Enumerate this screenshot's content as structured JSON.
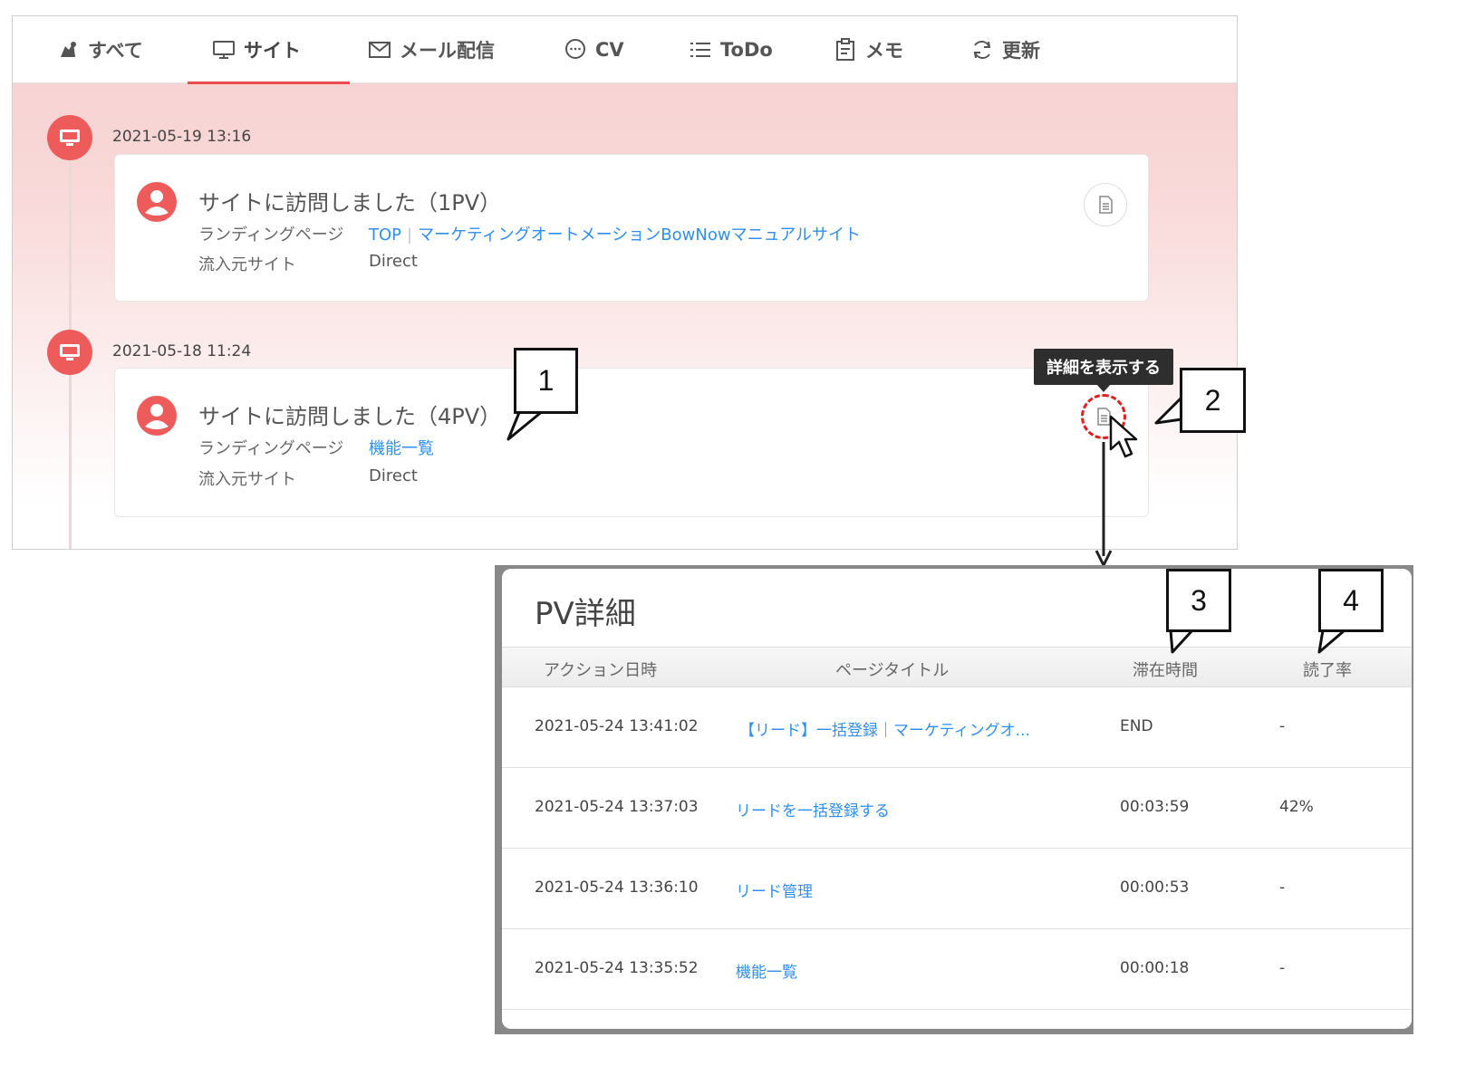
{
  "tabs": [
    {
      "label": "すべて",
      "icon": "all-icon"
    },
    {
      "label": "サイト",
      "icon": "monitor-icon",
      "active": true
    },
    {
      "label": "メール配信",
      "icon": "mail-icon"
    },
    {
      "label": "CV",
      "icon": "chat-bubble-icon"
    },
    {
      "label": "ToDo",
      "icon": "list-icon"
    },
    {
      "label": "メモ",
      "icon": "clipboard-icon"
    },
    {
      "label": "更新",
      "icon": "refresh-icon"
    }
  ],
  "timeline": [
    {
      "date": "2021-05-19 13:16",
      "title": "サイトに訪問しました（1PV）",
      "landing_label": "ランディングページ",
      "landing_link_1": "TOP",
      "landing_sep": "|",
      "landing_link_2": "マーケティングオートメーションBowNowマニュアルサイト",
      "referrer_label": "流入元サイト",
      "referrer_value": "Direct"
    },
    {
      "date": "2021-05-18 11:24",
      "title": "サイトに訪問しました（4PV）",
      "landing_label": "ランディングページ",
      "landing_link_1": "機能一覧",
      "referrer_label": "流入元サイト",
      "referrer_value": "Direct"
    }
  ],
  "tooltip": "詳細を表示する",
  "callouts": [
    "1",
    "2",
    "3",
    "4"
  ],
  "modal": {
    "title": "PV詳細",
    "columns": [
      "アクション日時",
      "ページタイトル",
      "滞在時間",
      "読了率"
    ],
    "rows": [
      {
        "datetime": "2021-05-24 13:41:02",
        "page": "【リード】一括登録｜マーケティングオ...",
        "duration": "END",
        "read_rate": "-"
      },
      {
        "datetime": "2021-05-24 13:37:03",
        "page": "リードを一括登録する",
        "duration": "00:03:59",
        "read_rate": "42%"
      },
      {
        "datetime": "2021-05-24 13:36:10",
        "page": "リード管理",
        "duration": "00:00:53",
        "read_rate": "-"
      },
      {
        "datetime": "2021-05-24 13:35:52",
        "page": "機能一覧",
        "duration": "00:00:18",
        "read_rate": "-"
      }
    ]
  },
  "colors": {
    "accent": "#ee5b5b",
    "link": "#2f8ef0",
    "highlight": "#e02020"
  }
}
